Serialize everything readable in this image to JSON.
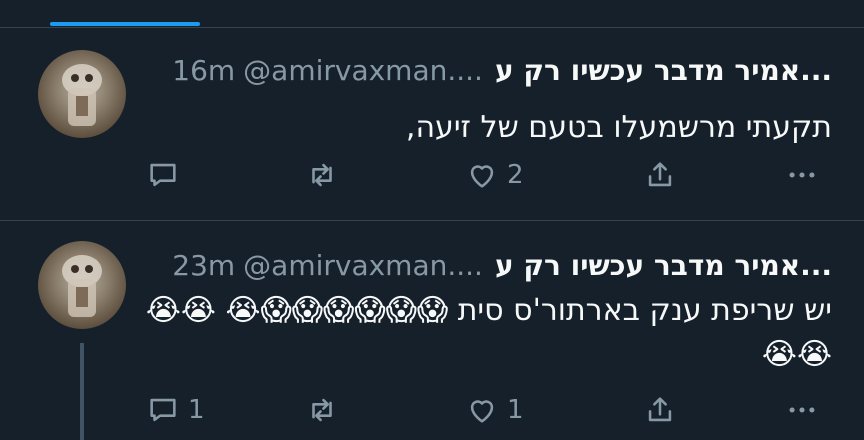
{
  "tweets": [
    {
      "name": "...אמיר מדבר עכשיו רק ע",
      "handle": "@amirvaxman....",
      "time": "16m",
      "text": "תקעתי מרשמעלו בטעם של זיעה,",
      "reply_count": "",
      "retweet_count": "",
      "like_count": "2"
    },
    {
      "name": "...אמיר מדבר עכשיו רק ע",
      "handle": "@amirvaxman....",
      "time": "23m",
      "text": "יש שריפת ענק בארתור'ס סית 😱😱😱😱😱😱😭 😭😭😭😭",
      "reply_count": "1",
      "retweet_count": "",
      "like_count": "1"
    }
  ],
  "icons": {
    "reply": "reply-icon",
    "retweet": "retweet-icon",
    "like": "heart-icon",
    "share": "share-icon",
    "more": "more-icon"
  },
  "colors": {
    "background": "#15202b",
    "accent": "#1d9bf0",
    "muted": "#8899a6",
    "divider": "#38444d"
  }
}
